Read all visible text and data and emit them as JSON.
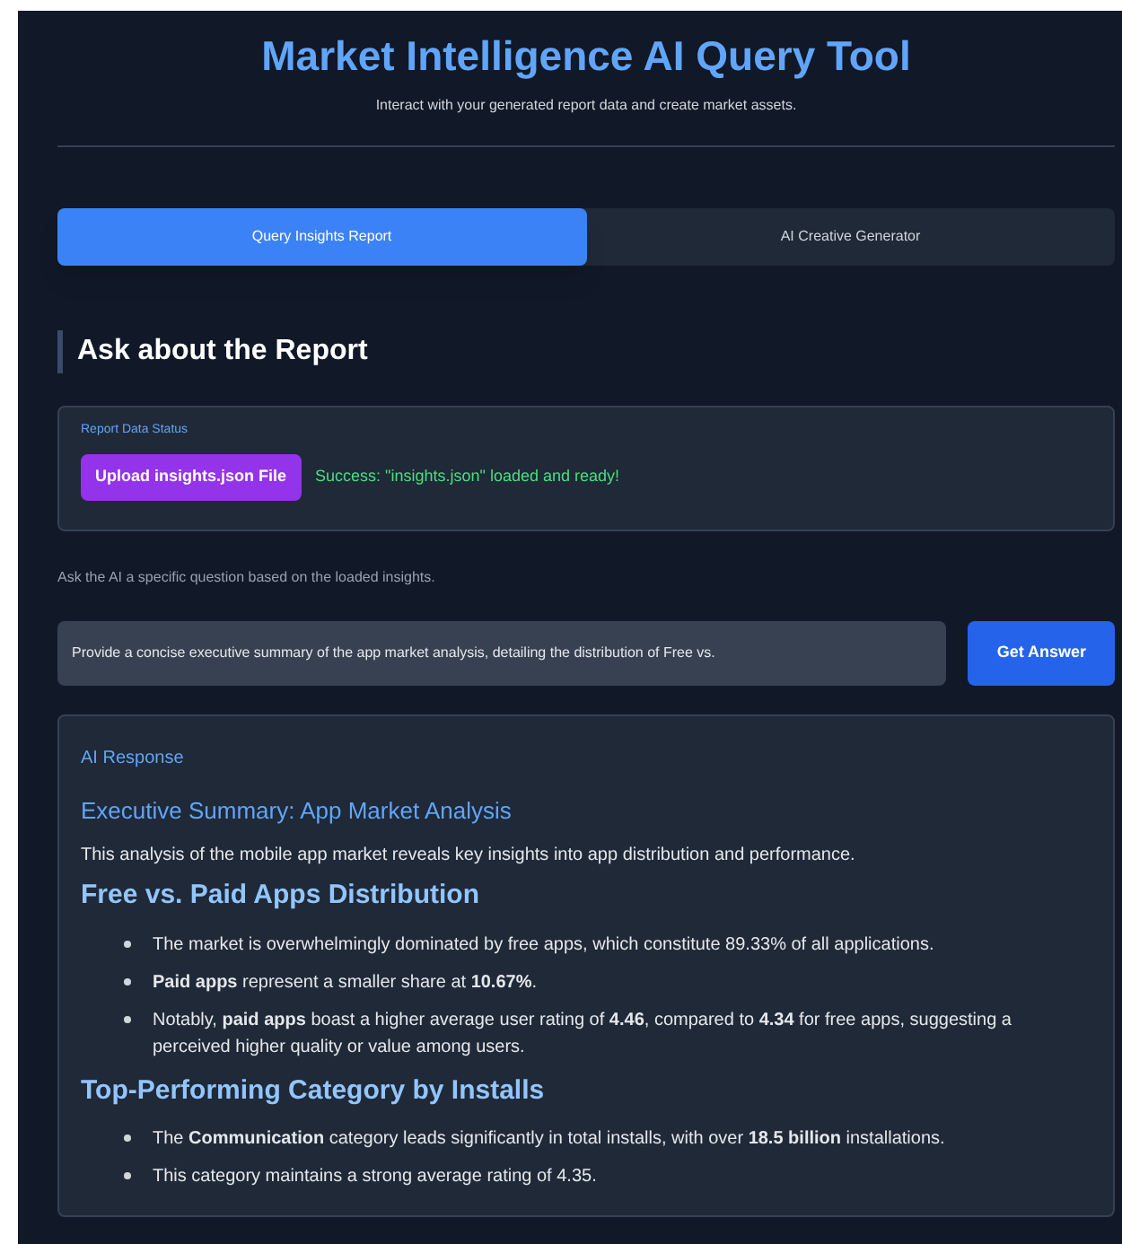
{
  "header": {
    "title": "Market Intelligence AI Query Tool",
    "subtitle": "Interact with your generated report data and create market assets."
  },
  "tabs": [
    {
      "label": "Query Insights Report",
      "selected": true
    },
    {
      "label": "AI Creative Generator",
      "selected": false
    }
  ],
  "section_title": "Ask about the Report",
  "status_card": {
    "label": "Report Data Status",
    "upload_button": "Upload insights.json File",
    "status": "Success: \"insights.json\" loaded and ready!"
  },
  "prompt": "Ask the AI a specific question based on the loaded insights.",
  "query": {
    "value": "Provide a concise executive summary of the app market analysis, detailing the distribution of Free vs.",
    "button": "Get Answer"
  },
  "response": {
    "label": "AI Response",
    "blocks": [
      {
        "kind": "title",
        "text": "Executive Summary: App Market Analysis"
      },
      {
        "kind": "paragraph",
        "text": "This analysis of the mobile app market reveals key insights into app distribution and performance."
      },
      {
        "kind": "heading",
        "text": "Free vs. Paid Apps Distribution"
      },
      {
        "kind": "list",
        "items": [
          "The market is overwhelmingly dominated by free apps, which constitute 89.33% of all applications.",
          "**Paid apps** represent a smaller share at **10.67%**.",
          "Notably, **paid apps** boast a higher average user rating of **4.46**, compared to **4.34** for free apps, suggesting a perceived higher quality or value among users."
        ]
      },
      {
        "kind": "heading",
        "text": "Top-Performing Category by Installs"
      },
      {
        "kind": "list",
        "items": [
          "The **Communication** category leads significantly in total installs, with over **18.5 billion** installations.",
          "This category maintains a strong average rating of 4.35."
        ]
      }
    ]
  }
}
